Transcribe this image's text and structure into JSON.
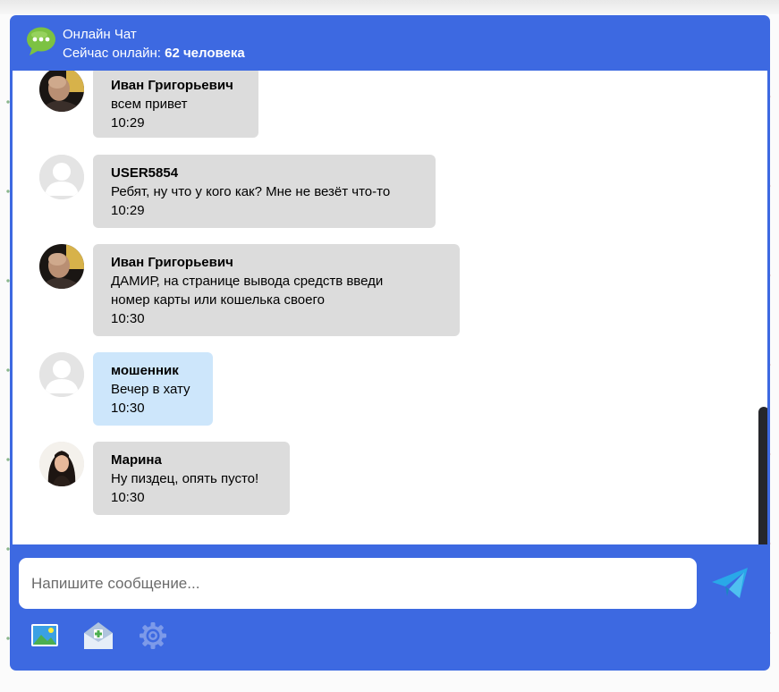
{
  "header": {
    "title": "Онлайн Чат",
    "online_label": "Сейчас онлайн:",
    "online_count": "62 человека"
  },
  "messages": [
    {
      "avatar": "user-photo-male",
      "author": "Иван Григорьевич",
      "lines": [
        "всем привет"
      ],
      "time": "10:29",
      "own": false
    },
    {
      "avatar": "default-avatar",
      "author": "USER5854",
      "lines": [
        "Ребят, ну что у кого как? Мне не везёт что-то"
      ],
      "time": "10:29",
      "own": false
    },
    {
      "avatar": "user-photo-male",
      "author": "Иван Григорьевич",
      "lines": [
        "ДАМИР, на странице вывода средств введи",
        "номер карты или кошелька своего"
      ],
      "time": "10:30",
      "own": false
    },
    {
      "avatar": "default-avatar",
      "author": "мошенник",
      "lines": [
        "Вечер в хату"
      ],
      "time": "10:30",
      "own": true
    },
    {
      "avatar": "user-photo-female",
      "author": "Марина",
      "lines": [
        "Ну пиздец, опять пусто!"
      ],
      "time": "10:30",
      "own": false
    }
  ],
  "composer": {
    "placeholder": "Напишите сообщение...",
    "value": ""
  },
  "icons": {
    "logo": "chat-bubble-icon",
    "send": "paper-plane-icon",
    "image": "image-icon",
    "mail": "mail-plus-icon",
    "settings": "gear-icon"
  },
  "colors": {
    "accent": "#3d69e1",
    "bubble": "#dcdcdc",
    "own_bubble": "#cde6fb",
    "send_icon": "#29a8e8",
    "scrollbar": "#26272b"
  }
}
